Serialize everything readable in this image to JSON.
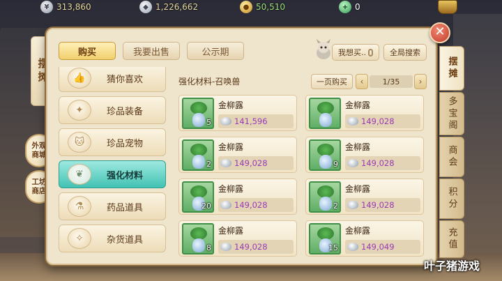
{
  "currency": {
    "silver": "313,860",
    "silver_bank": "1,226,662",
    "gold": "50,510",
    "jade": "0"
  },
  "left_panel": {
    "title": "摆摊",
    "badge_appearance": "外观商城",
    "badge_workshop": "工坊商店"
  },
  "tabs": [
    {
      "label": "购买",
      "active": true
    },
    {
      "label": "我要出售",
      "active": false
    },
    {
      "label": "公示期",
      "active": false
    }
  ],
  "tools": {
    "want_buy": "我想买..",
    "global_search": "全局搜索"
  },
  "categories": [
    {
      "label": "猜你喜欢",
      "icon": "thumbs-up-icon",
      "active": false
    },
    {
      "label": "珍品装备",
      "icon": "armor-icon",
      "active": false
    },
    {
      "label": "珍品宠物",
      "icon": "cat-icon",
      "active": false
    },
    {
      "label": "强化材料",
      "icon": "leaf-material-icon",
      "active": true
    },
    {
      "label": "药品道具",
      "icon": "medicine-icon",
      "active": false
    },
    {
      "label": "杂货道具",
      "icon": "sundries-icon",
      "active": false
    }
  ],
  "section": {
    "title": "强化材料-召唤兽",
    "buy_page": "一页购买",
    "page": "1/35"
  },
  "items": [
    {
      "name": "金柳露",
      "qty": "5",
      "price": "141,596"
    },
    {
      "name": "金柳露",
      "qty": "",
      "price": "149,028"
    },
    {
      "name": "金柳露",
      "qty": "2",
      "price": "149,028"
    },
    {
      "name": "金柳露",
      "qty": "9",
      "price": "149,028"
    },
    {
      "name": "金柳露",
      "qty": "20",
      "price": "149,028"
    },
    {
      "name": "金柳露",
      "qty": "2",
      "price": "149,028"
    },
    {
      "name": "金柳露",
      "qty": "8",
      "price": "149,028"
    },
    {
      "name": "金柳露",
      "qty": "15",
      "price": "149,049"
    }
  ],
  "right_tabs": [
    {
      "label": "摆摊",
      "active": true
    },
    {
      "label": "多宝阁",
      "active": false
    },
    {
      "label": "商会",
      "active": false
    },
    {
      "label": "积分",
      "active": false
    },
    {
      "label": "充值",
      "active": false
    }
  ],
  "watermark": "叶子猪游戏"
}
